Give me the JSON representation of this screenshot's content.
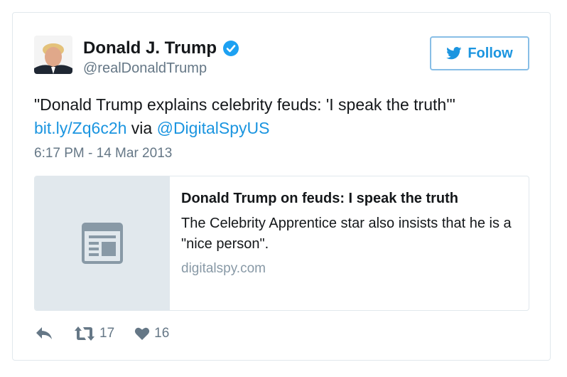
{
  "tweet": {
    "author_name": "Donald J. Trump",
    "author_handle": "@realDonaldTrump",
    "follow_label": "Follow",
    "text_quote": "\"Donald Trump explains celebrity feuds: 'I speak the truth'\"",
    "link_text": "bit.ly/Zq6c2h",
    "via_text": " via ",
    "mention_text": "@DigitalSpyUS",
    "timestamp": "6:17 PM - 14 Mar 2013",
    "card": {
      "title": "Donald Trump on feuds: I speak the truth",
      "description": "The Celebrity Apprentice star also insists that he is a \"nice person\".",
      "domain": "digitalspy.com"
    },
    "actions": {
      "retweet_count": "17",
      "like_count": "16"
    }
  },
  "colors": {
    "link": "#1b95e0",
    "verified": "#1da1f2",
    "muted": "#657786",
    "card_thumb_bg": "#e1e8ed"
  },
  "icons": [
    "verified-badge-icon",
    "twitter-bird-icon",
    "article-icon",
    "reply-icon",
    "retweet-icon",
    "heart-icon"
  ]
}
